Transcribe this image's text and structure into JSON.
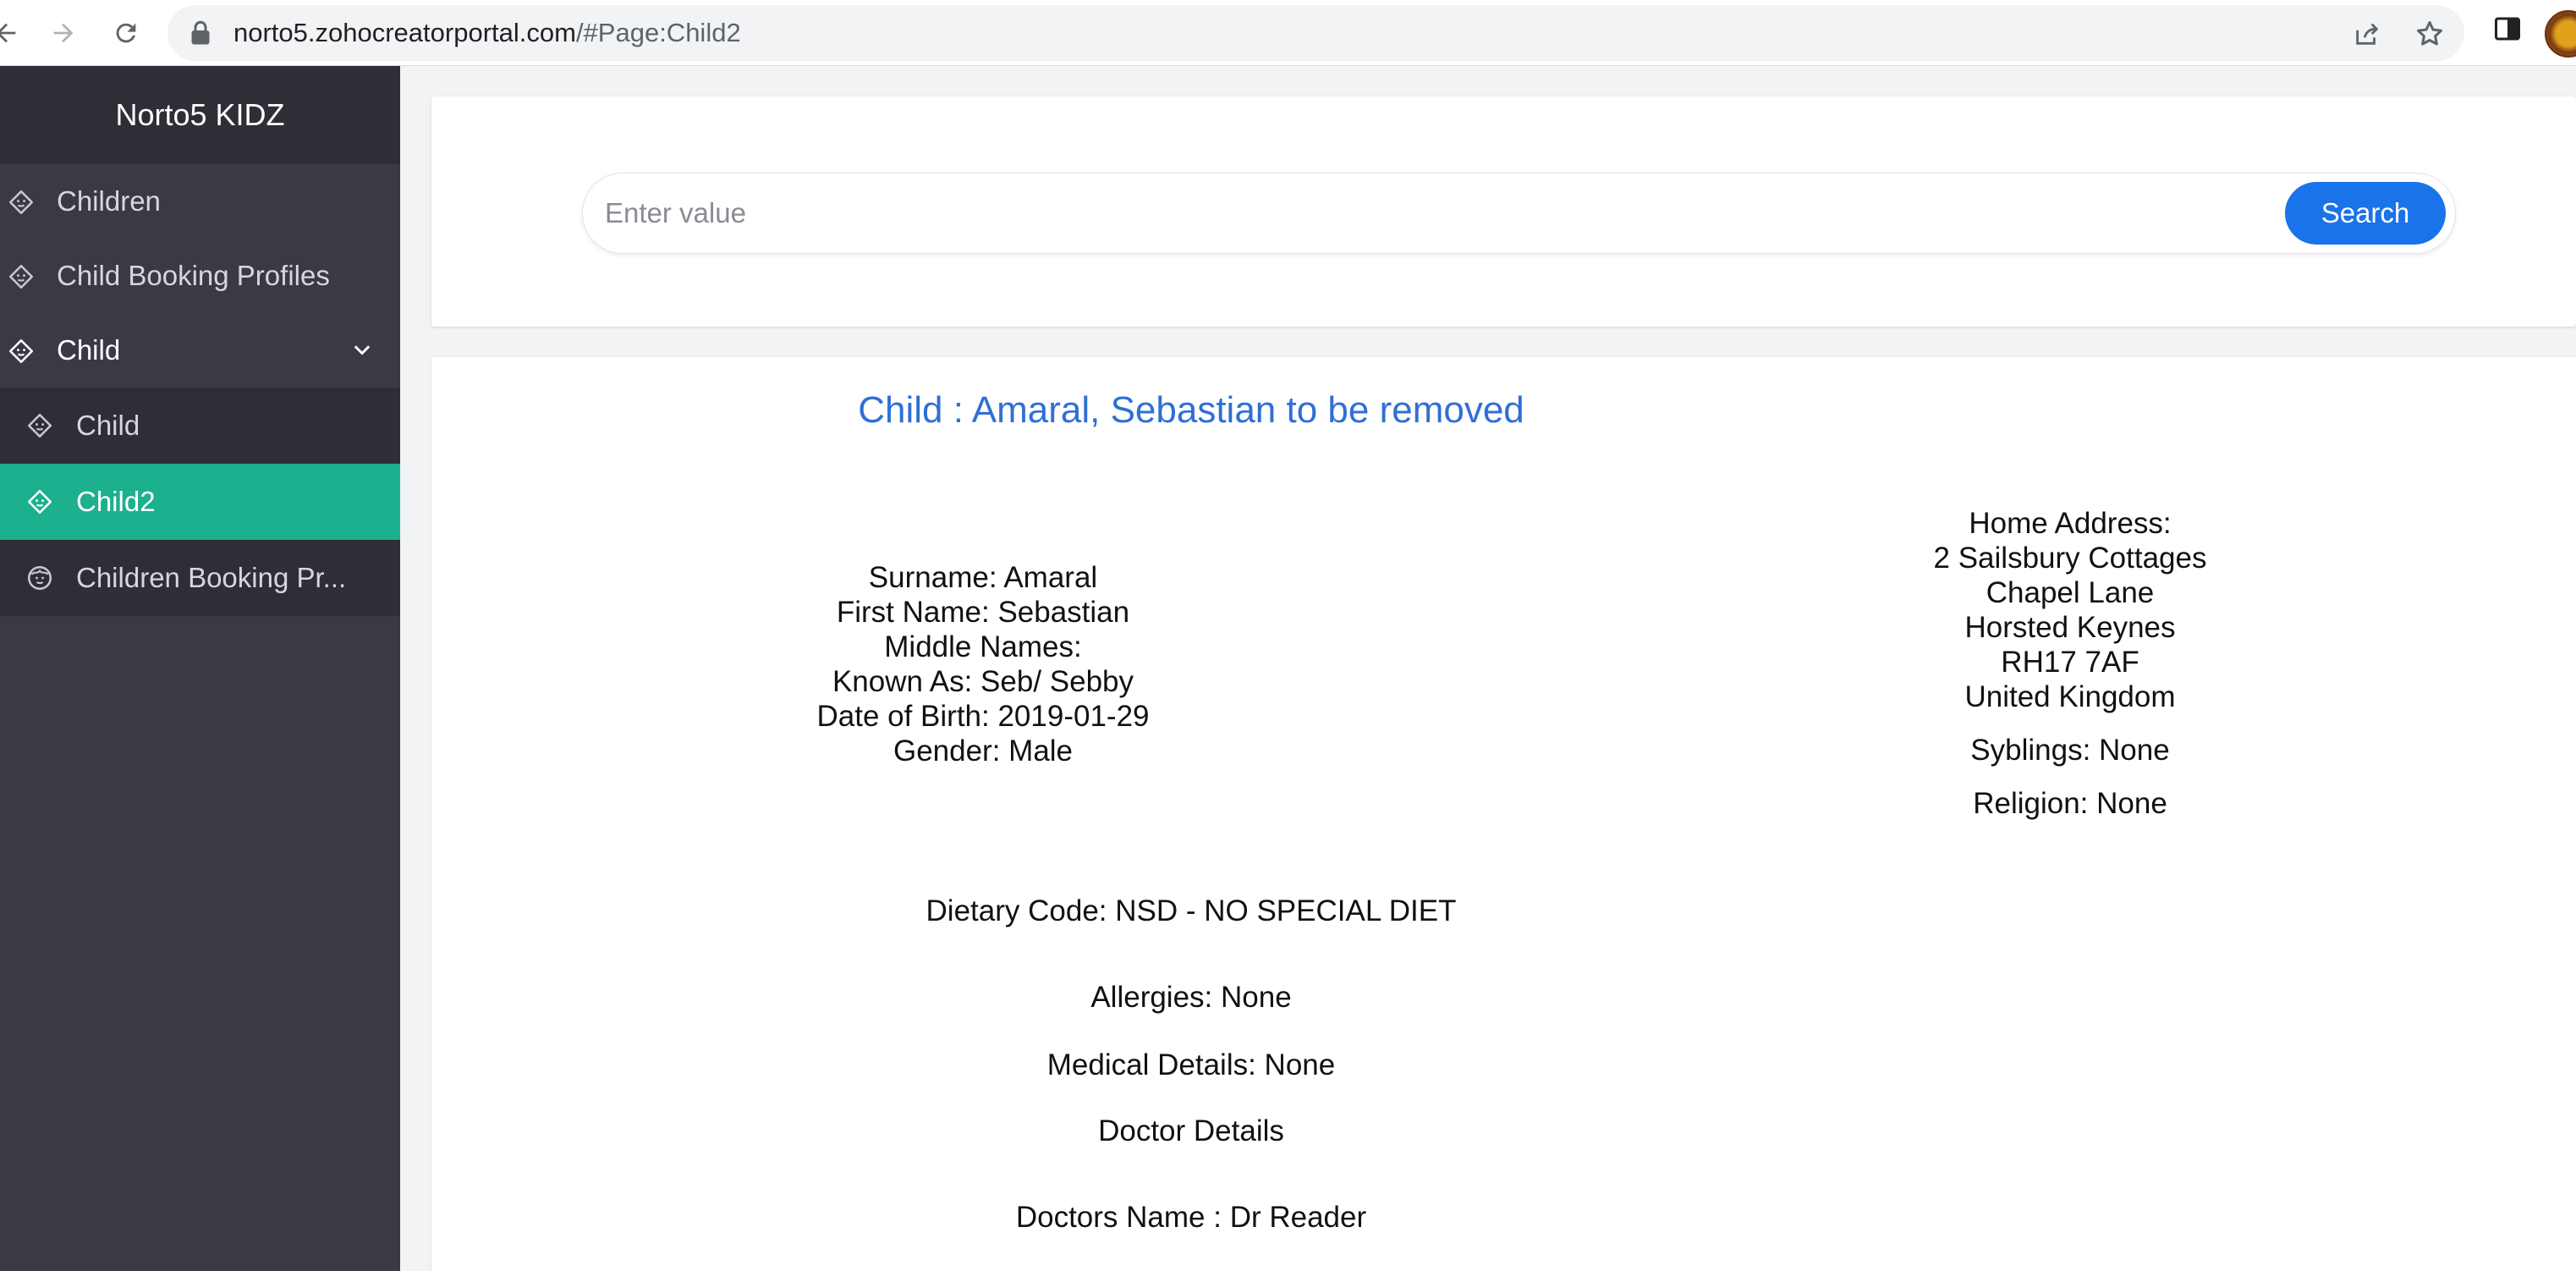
{
  "browser": {
    "url_host": "norto5.zohocreatorportal.com",
    "url_path": "/#Page:Child2"
  },
  "sidebar": {
    "brand": "Norto5 KIDZ",
    "items": [
      {
        "label": "Children"
      },
      {
        "label": "Child Booking Profiles"
      },
      {
        "label": "Child"
      }
    ],
    "subitems": [
      {
        "label": "Child"
      },
      {
        "label": "Child2"
      },
      {
        "label": "Children Booking Pr..."
      }
    ]
  },
  "search": {
    "placeholder": "Enter value",
    "button_label": "Search"
  },
  "record": {
    "title": "Child : Amaral, Sebastian to be removed",
    "surname": "Surname: Amaral",
    "first_name": "First Name: Sebastian",
    "middle_names": "Middle Names:",
    "known_as": "Known As: Seb/ Sebby",
    "dob": "Date of Birth: 2019-01-29",
    "gender": "Gender: Male",
    "home_address_label": "Home Address:",
    "address_lines": [
      "2 Sailsbury Cottages",
      "Chapel Lane",
      "Horsted Keynes",
      "RH17 7AF",
      "United Kingdom"
    ],
    "siblings": "Syblings: None",
    "religion": "Religion: None",
    "dietary": "Dietary Code: NSD - NO SPECIAL DIET",
    "allergies": "Allergies: None",
    "medical": "Medical Details: None",
    "doctor_heading": "Doctor Details",
    "doctor_name": "Doctors Name : Dr Reader"
  },
  "colors": {
    "sidebar_bg": "#3a3a45",
    "active_item": "#1cb08e",
    "title_blue": "#2f6fd6",
    "search_button": "#1a73e8"
  }
}
